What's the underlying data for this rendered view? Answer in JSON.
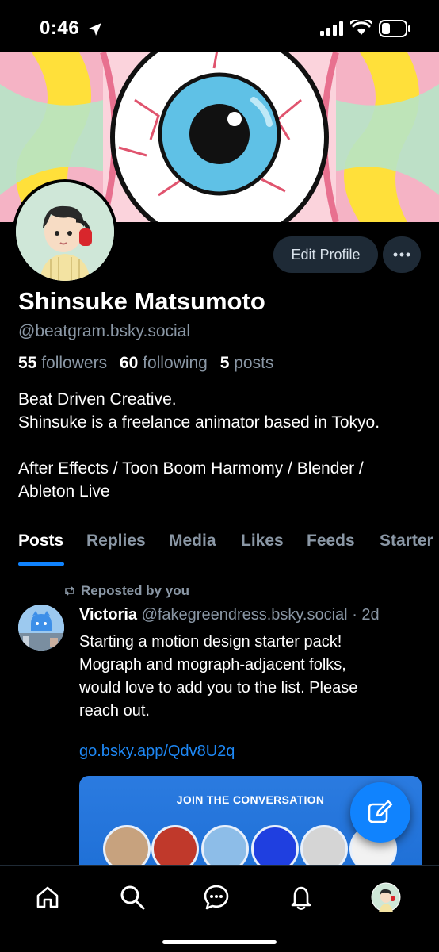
{
  "status_bar": {
    "time": "0:46"
  },
  "profile": {
    "display_name": "Shinsuke Matsumoto",
    "handle": "@beatgram.bsky.social",
    "followers_count": "55",
    "followers_label": "followers",
    "following_count": "60",
    "following_label": "following",
    "posts_count": "5",
    "posts_label": "posts",
    "bio": "Beat Driven Creative.\nShinsuke is a freelance animator based in Tokyo.\n\nAfter Effects / Toon Boom Harmomy / Blender /\nAbleton Live",
    "edit_button": "Edit Profile"
  },
  "tabs": [
    "Posts",
    "Replies",
    "Media",
    "Likes",
    "Feeds",
    "Starter"
  ],
  "active_tab": "Posts",
  "feed": {
    "repost_label": "Reposted by you",
    "post": {
      "author_name": "Victoria",
      "author_handle": "@fakegreendress.bsky.social",
      "time": "· 2d",
      "text": "Starting a motion design starter pack!\nMograph and mograph-adjacent folks,\nwould love to add you to the list. Please\nreach out.",
      "link": "go.bsky.app/Qdv8U2q",
      "card_title": "JOIN THE CONVERSATION"
    }
  },
  "bottom_nav": [
    "home-icon",
    "search-icon",
    "chat-icon",
    "bell-icon",
    "profile-avatar"
  ],
  "colors": {
    "accent": "#1083fe",
    "muted": "#8a97a5",
    "button_bg": "#1e2a36"
  }
}
